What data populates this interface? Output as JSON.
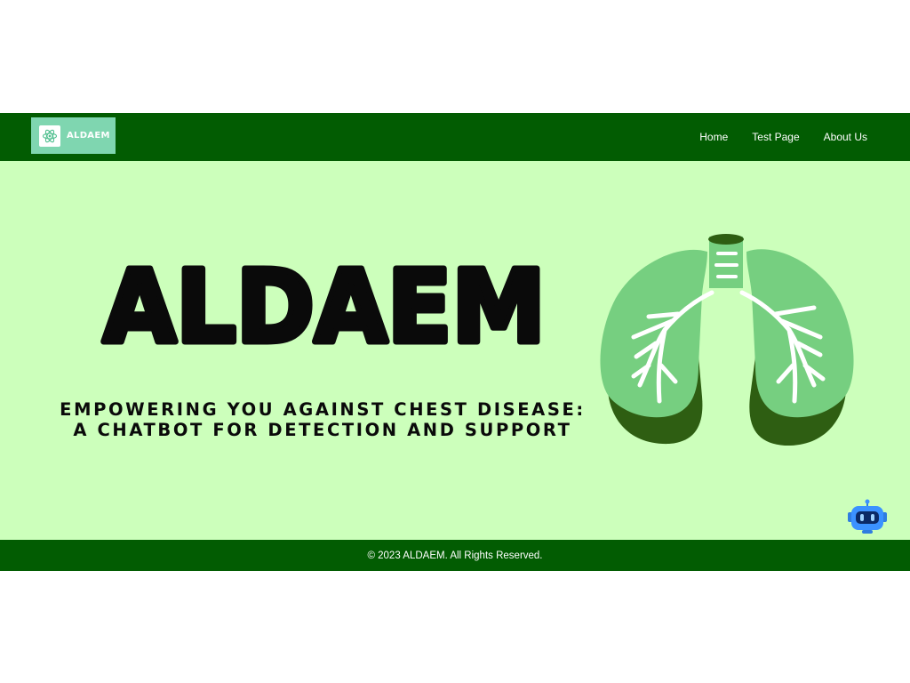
{
  "brand": {
    "name": "ALDAEM",
    "logo_text": "ALDAEM",
    "icon": "atom-icon"
  },
  "nav": {
    "items": [
      {
        "label": "Home"
      },
      {
        "label": "Test Page"
      },
      {
        "label": "About Us"
      }
    ]
  },
  "hero": {
    "title": "ALDAEM",
    "subtitle_line1": "EMPOWERING YOU AGAINST CHEST DISEASE:",
    "subtitle_line2": "A CHATBOT FOR DETECTION AND SUPPORT",
    "image": "lungs-illustration"
  },
  "chatbot": {
    "icon": "robot-icon"
  },
  "footer": {
    "text": "© 2023 ALDAEM. All Rights Reserved."
  },
  "colors": {
    "nav_bg": "#025c02",
    "hero_bg": "#ccffbb",
    "logo_bg": "#7fd6b0",
    "lung_light": "#76cf80",
    "lung_dark": "#2e5e12"
  }
}
